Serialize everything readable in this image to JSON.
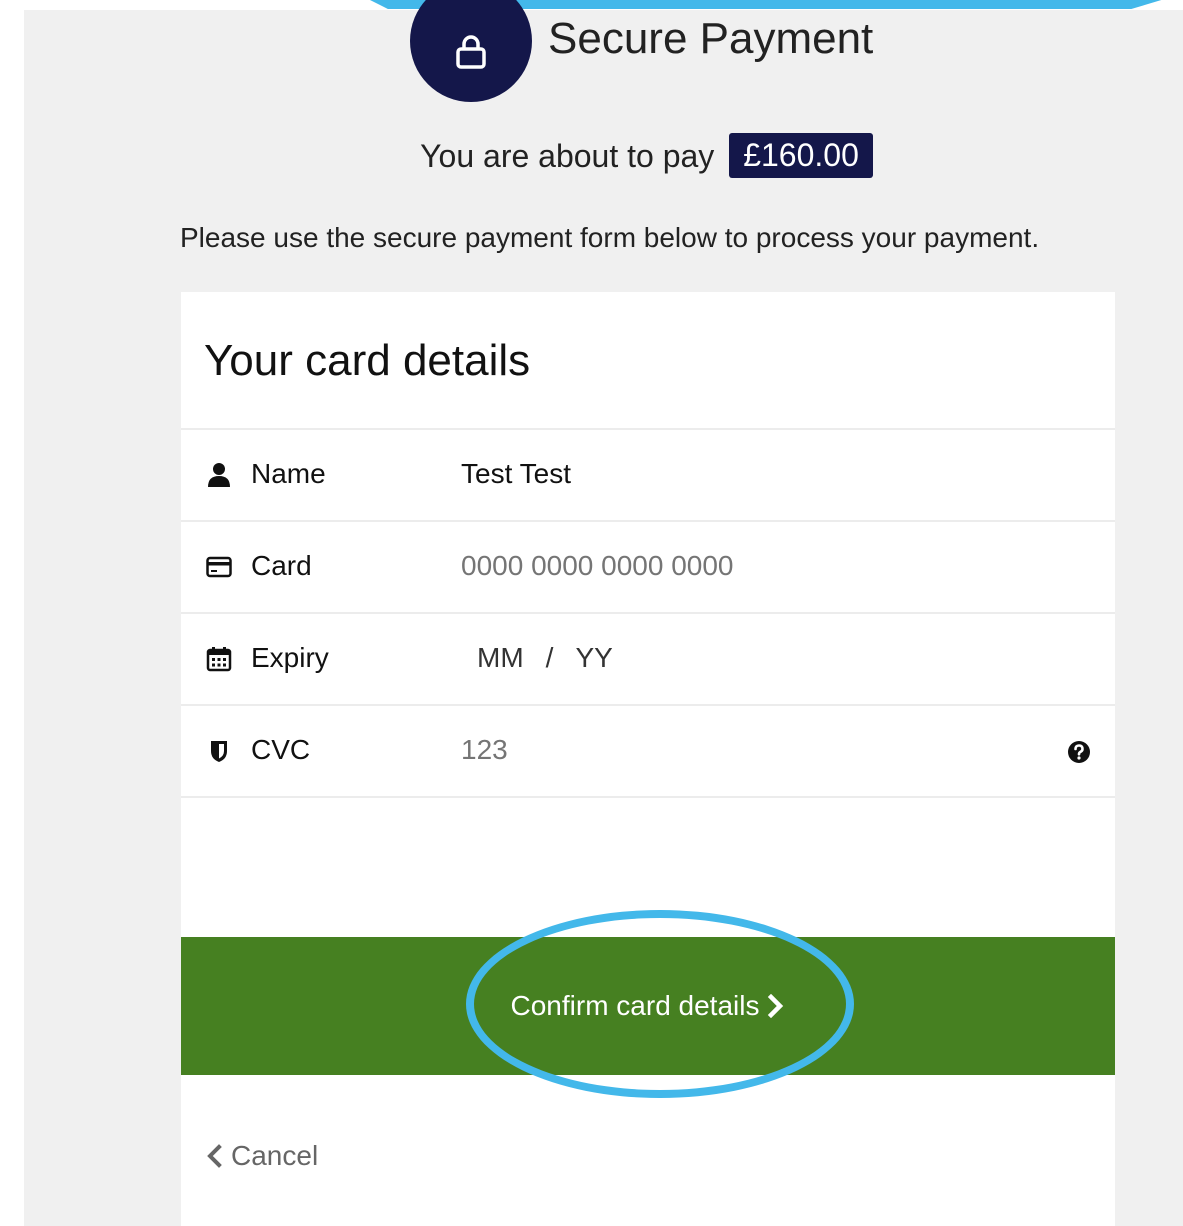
{
  "header": {
    "title": "Secure Payment",
    "lock_icon": "lock-icon"
  },
  "payment": {
    "prefix": "You are about to pay",
    "amount": "£160.00",
    "instructions": "Please use the secure payment form below to process your payment."
  },
  "card": {
    "heading": "Your card details",
    "fields": {
      "name": {
        "label": "Name",
        "value": "Test Test",
        "icon": "user-icon"
      },
      "card": {
        "label": "Card",
        "placeholder": "0000 0000 0000 0000",
        "icon": "credit-card-icon"
      },
      "expiry": {
        "label": "Expiry",
        "month_placeholder": "MM",
        "separator": "/",
        "year_placeholder": "YY",
        "icon": "calendar-icon"
      },
      "cvc": {
        "label": "CVC",
        "placeholder": "123",
        "icon": "shield-icon",
        "help_icon": "question-circle-icon"
      }
    }
  },
  "actions": {
    "confirm_label": "Confirm card details",
    "cancel_label": "Cancel"
  },
  "colors": {
    "navy": "#14174a",
    "green": "#468021",
    "annotation_blue": "#43b8ea",
    "page_background": "#f0f0f0"
  }
}
